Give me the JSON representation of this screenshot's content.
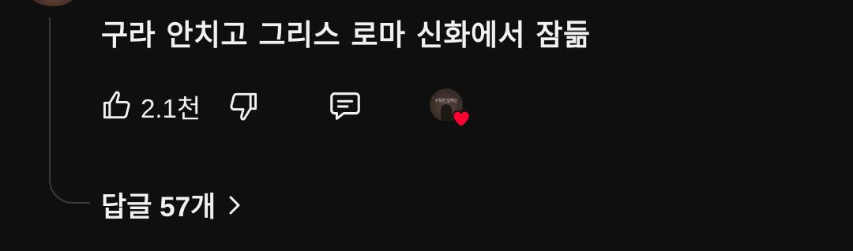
{
  "comment": {
    "text": "구라 안치고 그리스 로마 신화에서 잠듦"
  },
  "actions": {
    "like_count": "2.1천",
    "like_icon": "thumbs-up-icon",
    "dislike_icon": "thumbs-down-icon",
    "reply_icon": "comment-icon",
    "creator_heart_icon": "heart-icon",
    "creator_avatar_text": "구독만 날뛰는"
  },
  "replies": {
    "label": "답글 57개",
    "chevron_icon": "chevron-right-icon"
  },
  "colors": {
    "background": "#0f0f0f",
    "text": "#f1f1f1",
    "heart": "#ff0033",
    "thread_line": "#3a3a3a"
  }
}
